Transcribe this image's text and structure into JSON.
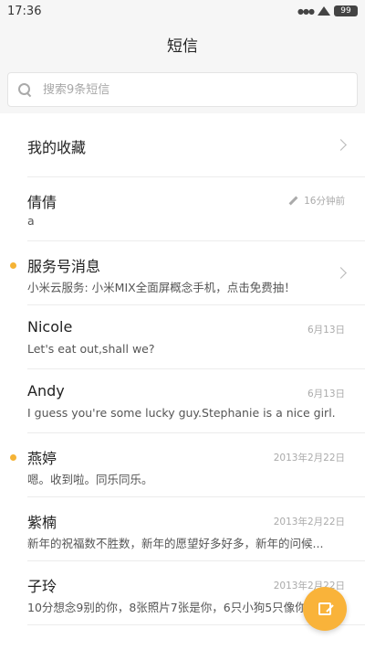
{
  "status_bar": {
    "time": "17:36",
    "signal": "●●●",
    "battery": "99"
  },
  "header": {
    "title": "短信"
  },
  "search": {
    "placeholder": "搜索9条短信"
  },
  "favorites": {
    "label": "我的收藏"
  },
  "conversations": [
    {
      "name": "倩倩",
      "preview": "a",
      "time": "16分钟前",
      "draft": true
    },
    {
      "name": "服务号消息",
      "preview": "小米云服务: 小米MIX全面屏概念手机，点击免费抽！",
      "unread": true
    },
    {
      "name": "Nicole",
      "preview": "Let's eat out,shall we?",
      "time": "6月13日"
    },
    {
      "name": "Andy",
      "preview": "I guess you're some lucky guy.Stephanie is a nice girl.",
      "time": "6月13日"
    },
    {
      "name": "燕婷",
      "preview": "嗯。收到啦。同乐同乐。",
      "time": "2013年2月22日",
      "unread": true
    },
    {
      "name": "紫楠",
      "preview": "新年的祝福数不胜数，新年的愿望好多好多，新年的问候...",
      "time": "2013年2月22日"
    },
    {
      "name": "子玲",
      "preview": "10分想念9别的你，8张照片7张是你，6只小狗5只像你",
      "time": "2013年2月22日"
    }
  ],
  "colors": {
    "accent": "#f9b33a",
    "unread_dot": "#f5b335"
  },
  "icons": [
    "search-icon",
    "chevron-right-icon",
    "pencil-icon",
    "compose-icon"
  ]
}
